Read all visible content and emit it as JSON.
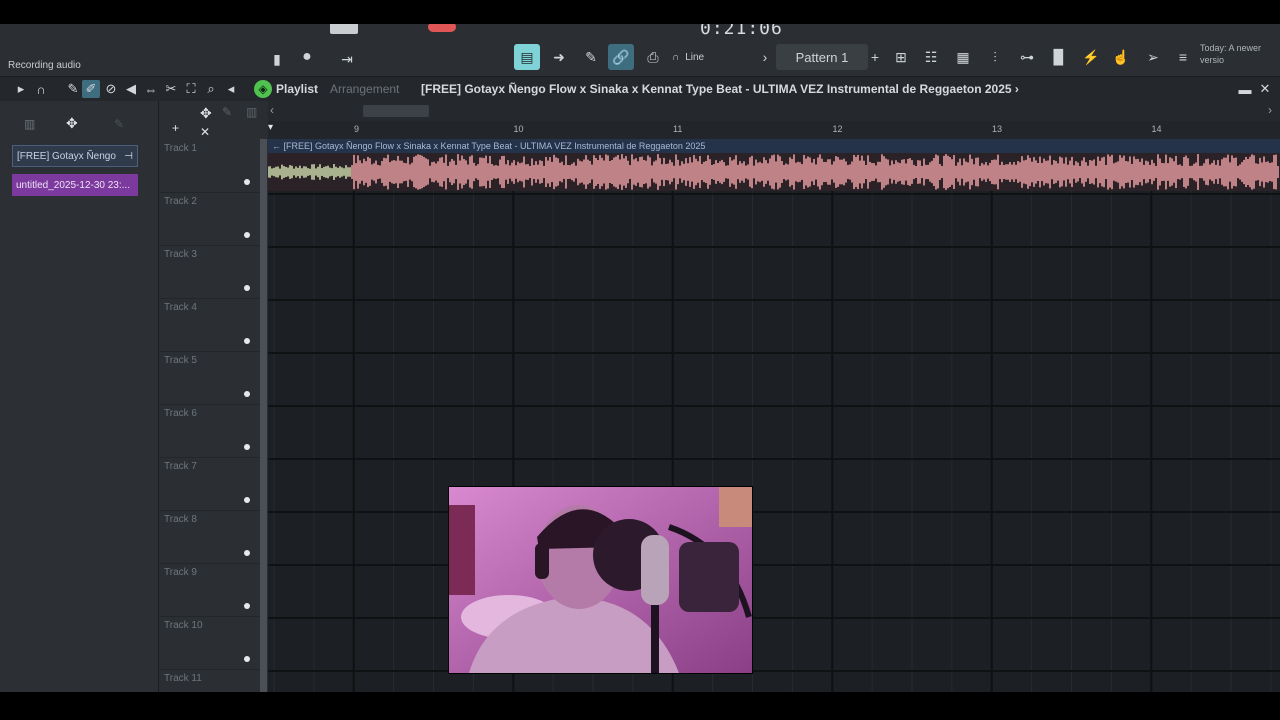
{
  "toolbar": {
    "time": "0:21:06",
    "hint": "Recording audio",
    "snap": "Line",
    "pattern": "Pattern 1",
    "hint_panel": "Today: A newer versio"
  },
  "playlist": {
    "title": "Playlist",
    "subtitle": "Arrangement",
    "breadcrumb": "[FREE] Gotayx Ñengo Flow x Sinaka x Kennat Type Beat - ULTIMA VEZ  Instrumental de Reggaeton 2025 ›"
  },
  "browser": {
    "audio_clip": "[FREE] Gotayx Ñengo",
    "pattern_clip": "untitled_2025-12-30 23:..."
  },
  "tracks": [
    "Track 1",
    "Track 2",
    "Track 3",
    "Track 4",
    "Track 5",
    "Track 6",
    "Track 7",
    "Track 8",
    "Track 9",
    "Track 10",
    "Track 11"
  ],
  "ruler": [
    "9",
    "10",
    "11",
    "12",
    "13",
    "14"
  ],
  "clip": {
    "label": "← [FREE] Gotayx Ñengo Flow x Sinaka x Kennat Type Beat - ULTIMA VEZ  Instrumental de Reggaeton 2025",
    "colors": {
      "intro": "#c9d6a8",
      "body": "#e59a9f",
      "background": "#2a2226"
    }
  },
  "colors": {
    "accent": "#7fd3d6",
    "pattern_clip": "#7c3a9e",
    "webcam_tint": "#c86fb6"
  }
}
